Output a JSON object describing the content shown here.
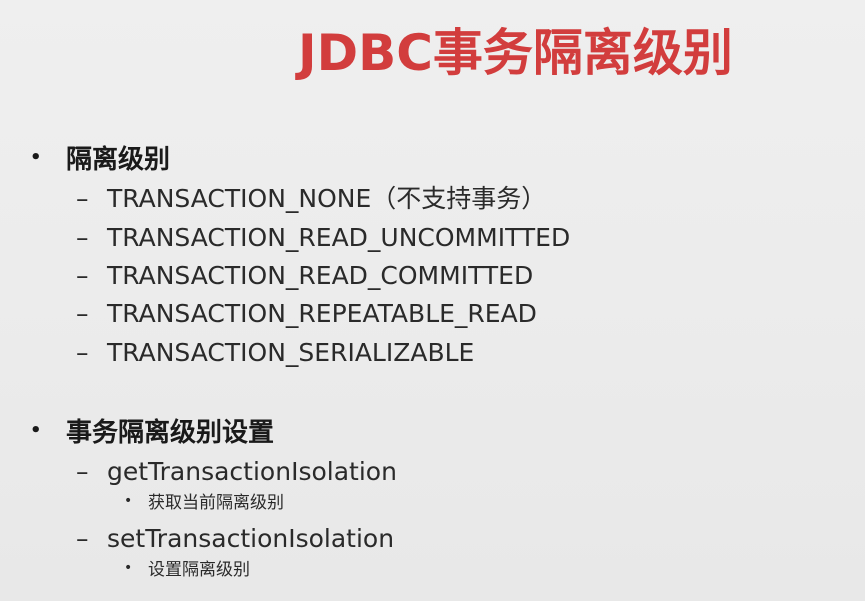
{
  "slide": {
    "title": "JDBC事务隔离级别",
    "sections": [
      {
        "bullet": "•",
        "heading": "隔离级别",
        "items": [
          {
            "dash": "–",
            "text": "TRANSACTION_NONE（不支持事务）"
          },
          {
            "dash": "–",
            "text": "TRANSACTION_READ_UNCOMMITTED"
          },
          {
            "dash": "–",
            "text": "TRANSACTION_READ_COMMITTED"
          },
          {
            "dash": "–",
            "text": "TRANSACTION_REPEATABLE_READ"
          },
          {
            "dash": "–",
            "text": "TRANSACTION_SERIALIZABLE"
          }
        ]
      },
      {
        "bullet": "•",
        "heading": "事务隔离级别设置",
        "items": [
          {
            "dash": "–",
            "text": "getTransactionIsolation",
            "sub": {
              "dot": "•",
              "text": "获取当前隔离级别"
            }
          },
          {
            "dash": "–",
            "text": "setTransactionIsolation",
            "sub": {
              "dot": "•",
              "text": "设置隔离级别"
            }
          }
        ]
      }
    ]
  }
}
